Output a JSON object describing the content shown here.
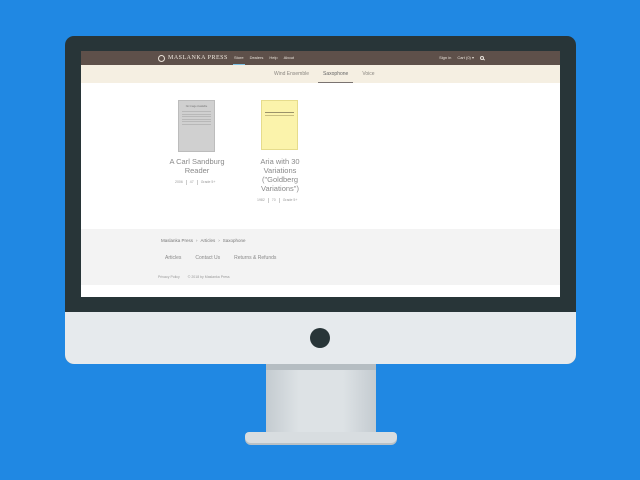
{
  "nav": {
    "logo": "MASLANKA PRESS",
    "links": [
      "Store",
      "Dealers",
      "Help",
      "About"
    ],
    "active": "Store",
    "sign_in": "Sign in",
    "cart": "Cart (0) ▾"
  },
  "tabs": [
    "Wind Ensemble",
    "Saxophone",
    "Voice"
  ],
  "active_tab": "Saxophone",
  "products": [
    {
      "title": "A Carl Sandburg Reader",
      "cover_title": "No Image Available",
      "meta": [
        "2006",
        "47",
        "Grade 5+"
      ],
      "cover_color": "#d0d0d0"
    },
    {
      "title": "Aria with 30 Variations (\"Goldberg Variations\")",
      "cover_title": "",
      "meta": [
        "1982",
        "70",
        "Grade 5+"
      ],
      "cover_color": "#fbf3ab"
    }
  ],
  "breadcrumb": [
    "Maslanka Press",
    "›",
    "Articles",
    "›",
    "Saxophone"
  ],
  "footer_links": [
    "Articles",
    "Contact Us",
    "Returns & Refunds"
  ],
  "privacy": "Privacy Policy",
  "copyright": "© 2018 by Maslanka Press",
  "colors": {
    "background": "#2088e3",
    "nav": "#5e504a",
    "subnav": "#f5efe2",
    "accent": "#7ec3e6"
  }
}
